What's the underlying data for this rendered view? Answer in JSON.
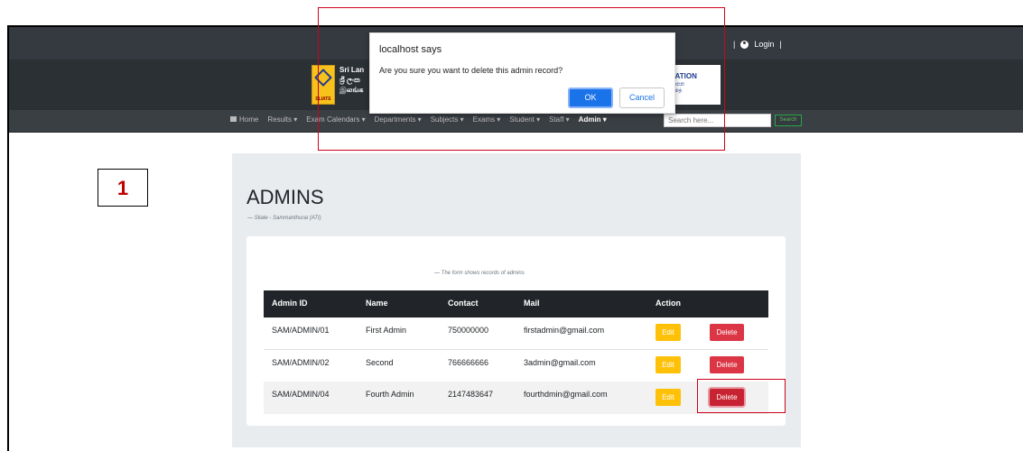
{
  "step": {
    "number": "1"
  },
  "header": {
    "login_label": "Login",
    "login_separator_left": "|",
    "login_separator_right": "|",
    "banner_left_lines": [
      "Sri Lan",
      "ශ්‍රී ලංක",
      "இலங்க"
    ],
    "logo_text": "SLIATE",
    "edu_title": "UCATION",
    "edu_sub_lines": [
      "අධ්‍යාපන",
      "கல்வித்"
    ],
    "nav": [
      {
        "label": "Home ",
        "active": false
      },
      {
        "label": "Results ▾",
        "active": false
      },
      {
        "label": "Exam Calendars ▾",
        "active": false
      },
      {
        "label": "Departments ▾",
        "active": false
      },
      {
        "label": "Subjects ▾",
        "active": false
      },
      {
        "label": "Exams ▾",
        "active": false
      },
      {
        "label": "Student ▾",
        "active": false
      },
      {
        "label": "Staff ▾",
        "active": false
      },
      {
        "label": "Admin ▾",
        "active": true
      }
    ],
    "search_placeholder": "Search here...",
    "search_button": "Search"
  },
  "dialog": {
    "title": "localhost says",
    "message": "Are you sure you want to delete this admin record?",
    "ok_label": "OK",
    "cancel_label": "Cancel"
  },
  "page": {
    "title": "ADMINS",
    "subtitle": "— Sliate - Sammanthurai (ATI)",
    "caption": "— The form shows records of admins"
  },
  "table": {
    "headers": [
      "Admin ID",
      "Name",
      "Contact",
      "Mail",
      "Action"
    ],
    "rows": [
      {
        "id": "SAM/ADMIN/01",
        "name": "First Admin",
        "contact": "750000000",
        "mail": "firstadmin@gmail.com",
        "edit": "Edit",
        "delete": "Delete"
      },
      {
        "id": "SAM/ADMIN/02",
        "name": "Second",
        "contact": "766666666",
        "mail": "3admin@gmail.com",
        "edit": "Edit",
        "delete": "Delete"
      },
      {
        "id": "SAM/ADMIN/04",
        "name": "Fourth Admin",
        "contact": "2147483647",
        "mail": "fourthdmin@gmail.com",
        "edit": "Edit",
        "delete": "Delete"
      }
    ]
  },
  "colors": {
    "accent": "#1a73e8",
    "danger": "#dc3545",
    "warning": "#ffc107",
    "highlight": "#d0021b"
  }
}
